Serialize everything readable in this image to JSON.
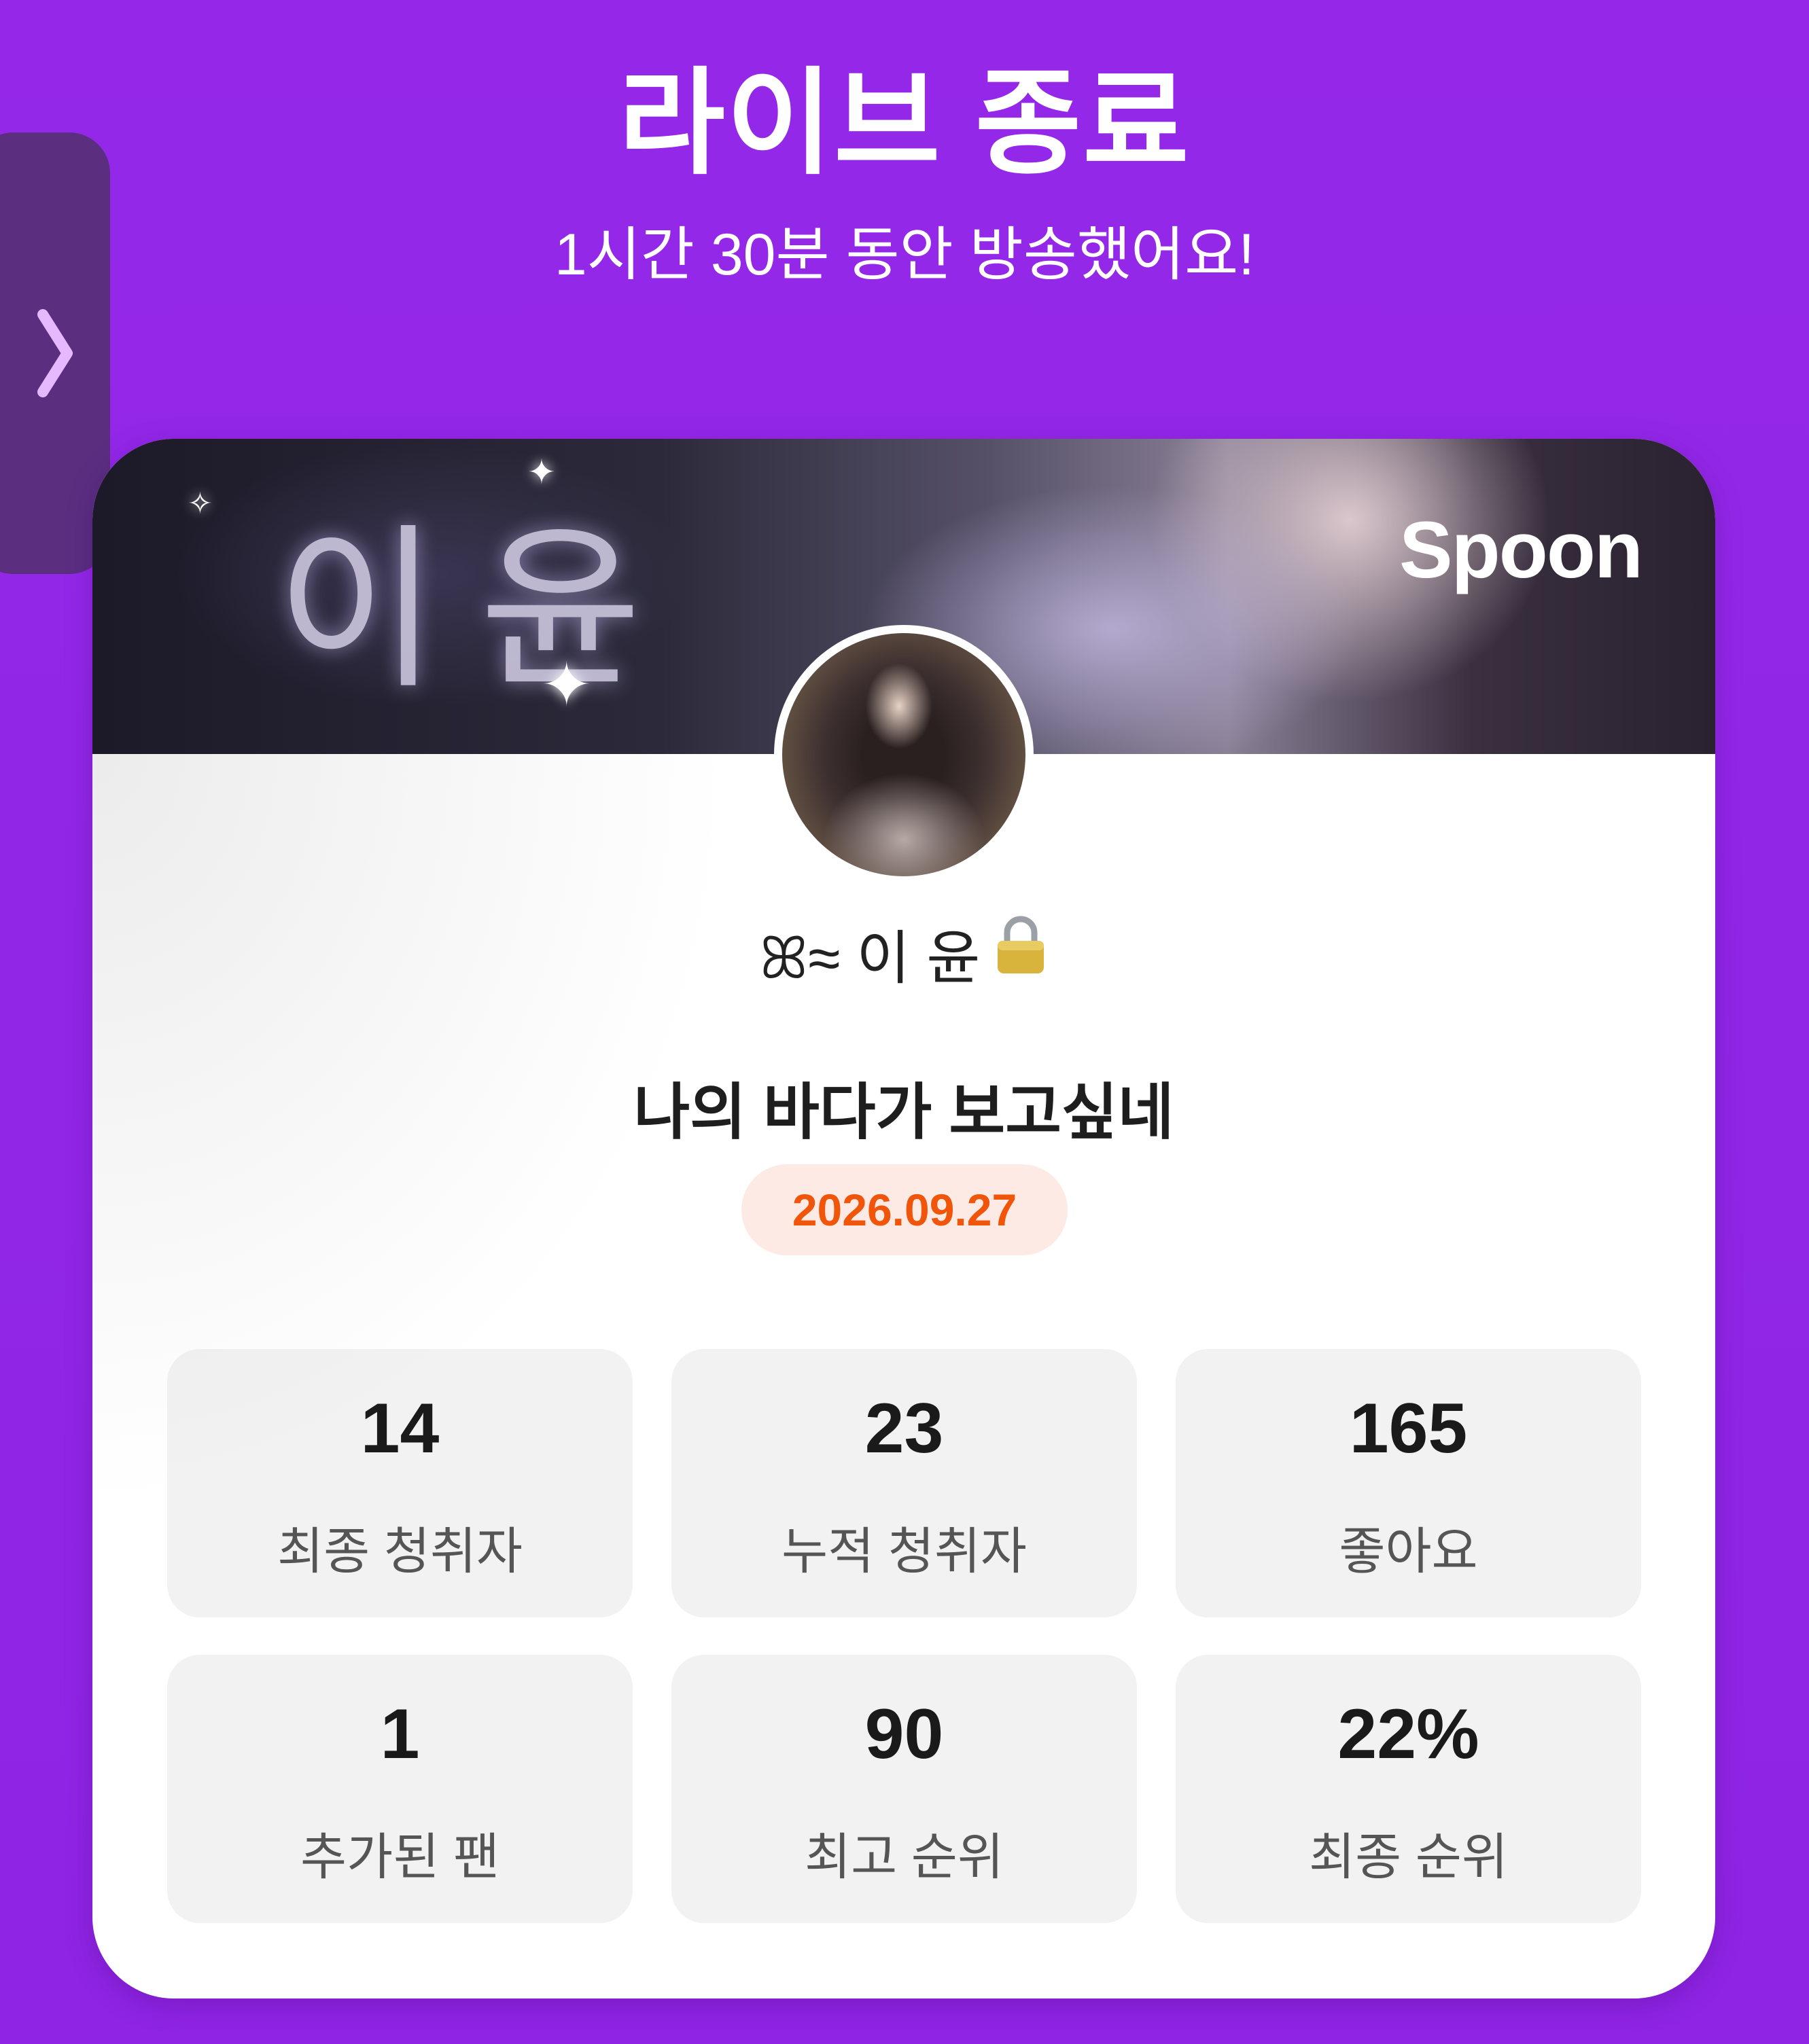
{
  "header": {
    "title": "라이브 종료",
    "subtitle": "1시간 30분 동안 방송했어요!"
  },
  "side_tab": {
    "icon": "chevron-right-icon",
    "color": "#e6b8ff"
  },
  "card": {
    "banner_logo": "Spoon",
    "banner_art_text": "이윤",
    "username": "ꕤ≈ 이 윤",
    "username_icon": "lock-icon",
    "live_title": "나의 바다가 보고싶네",
    "date": "2026.09.27",
    "stats": [
      {
        "value": "14",
        "label": "최종 청취자"
      },
      {
        "value": "23",
        "label": "누적 청취자"
      },
      {
        "value": "165",
        "label": "좋아요"
      },
      {
        "value": "1",
        "label": "추가된 팬"
      },
      {
        "value": "90",
        "label": "최고 순위"
      },
      {
        "value": "22%",
        "label": "최종 순위"
      }
    ]
  },
  "colors": {
    "background": "#9324e6",
    "date_text": "#f0550a",
    "date_bg": "#fdeae4",
    "stat_bg": "#f2f2f2"
  }
}
